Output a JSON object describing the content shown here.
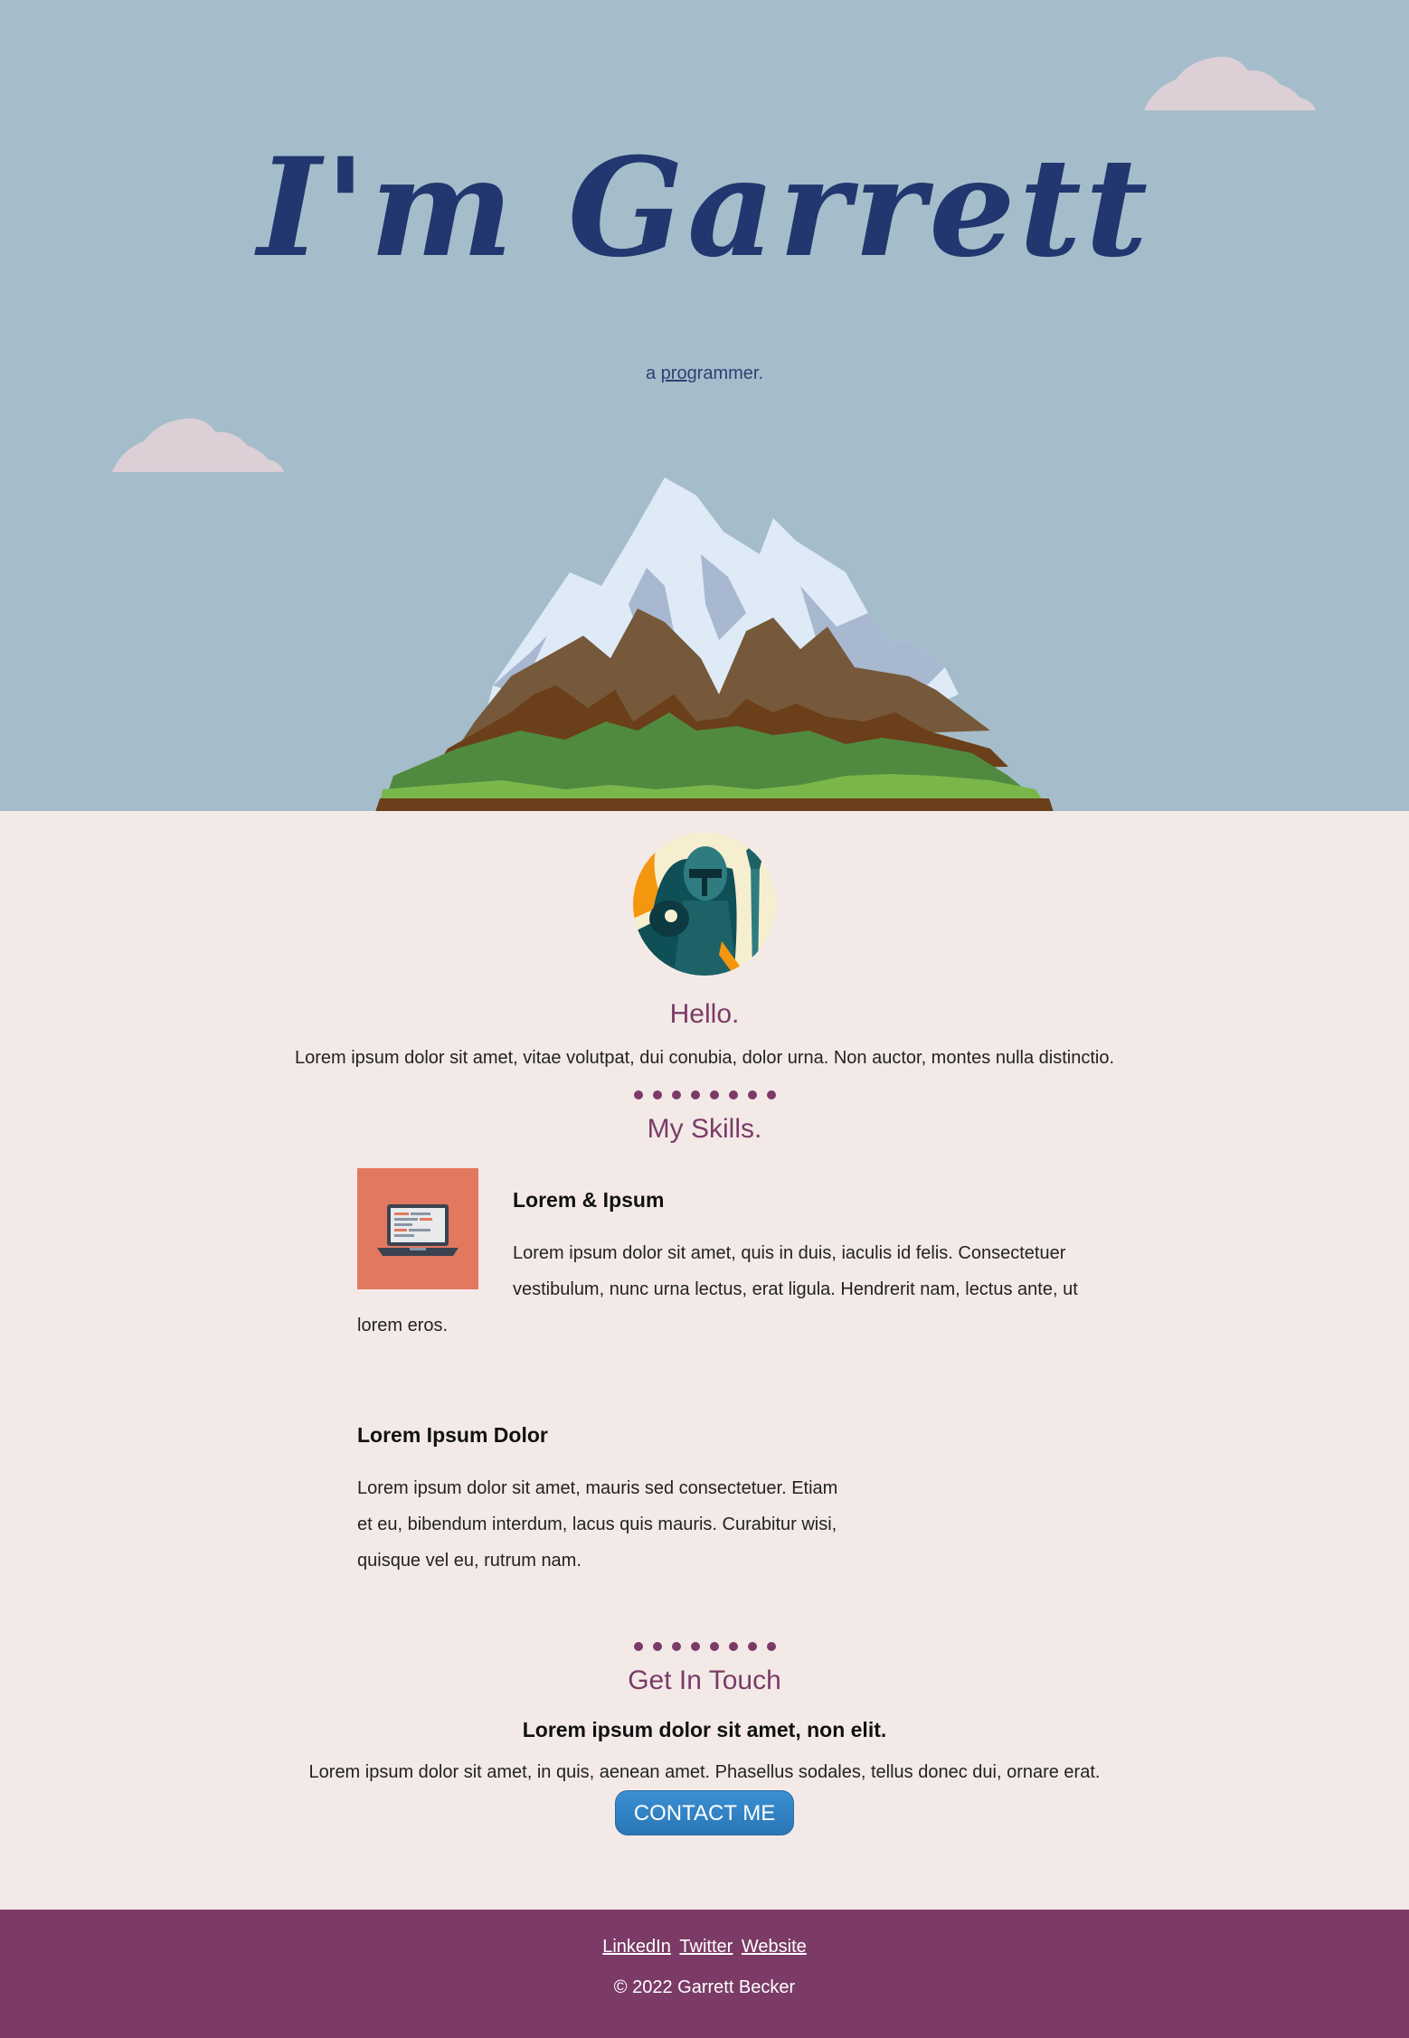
{
  "hero": {
    "title": "I'm Garrett",
    "subtitle_prefix": "a ",
    "subtitle_underlined": "pro",
    "subtitle_rest": "grammer."
  },
  "about": {
    "title": "Hello.",
    "text": "Lorem ipsum dolor sit amet, vitae volutpat, dui conubia, dolor urna. Non auctor, montes nulla distinctio."
  },
  "skills": {
    "title": "My Skills.",
    "items": [
      {
        "title": "Lorem & Ipsum",
        "text": "Lorem ipsum dolor sit amet, quis in duis, iaculis id felis. Consectetuer vestibulum, nunc urna lectus, erat ligula. Hendrerit nam, lectus ante, ut lorem eros."
      },
      {
        "title": "Lorem Ipsum Dolor",
        "text": "Lorem ipsum dolor sit amet, mauris sed consectetuer. Etiam et eu, bibendum interdum, lacus quis mauris. Curabitur wisi, quisque vel eu, rutrum nam."
      }
    ]
  },
  "contact": {
    "title": "Get In Touch",
    "strong": "Lorem ipsum dolor sit amet, non elit.",
    "text": "Lorem ipsum dolor sit amet, in quis, aenean amet. Phasellus sodales, tellus donec dui, ornare erat.",
    "button_label": "CONTACT ME"
  },
  "footer": {
    "links": [
      "LinkedIn",
      "Twitter",
      "Website"
    ],
    "copyright": "© 2022 Garrett Becker"
  },
  "colors": {
    "sky": "#a5bdca",
    "title": "#22376f",
    "accent": "#7b3b66",
    "background": "#f3eae8",
    "button": "#2f83c6",
    "skill_tile": "#e37860"
  }
}
